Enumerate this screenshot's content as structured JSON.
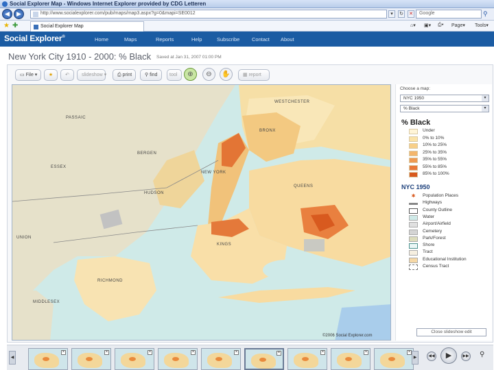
{
  "browser": {
    "title": "Social Explorer Map - Windows Internet Explorer provided by CDG Letteren",
    "address": "http://www.socialexplorer.com/pub/maps/map3.aspx?g=0&mapi=SE0012",
    "search_placeholder": "Google",
    "tab_label": "Social Explorer Map",
    "command_page": "Page",
    "command_tools": "Tools"
  },
  "site": {
    "logo": "Social Explorer",
    "logo_mark": "®",
    "nav": [
      "Home",
      "Maps",
      "Reports",
      "Help",
      "Subscribe",
      "Contact",
      "About"
    ]
  },
  "page": {
    "title": "New York City 1910 - 2000: % Black",
    "saved": "Saved at Jan 31, 2007 01:00 PM"
  },
  "toolbar": {
    "file": "File",
    "slideshow": "slideshow",
    "print": "print",
    "find": "find",
    "tool": "tool",
    "report": "report"
  },
  "map": {
    "labels": {
      "westchester": "WESTCHESTER",
      "passaic": "PASSAIC",
      "bergen": "BERGEN",
      "bronx": "BRONX",
      "essex": "ESSEX",
      "newyork": "NEW YORK",
      "hudson": "HUDSON",
      "queens": "QUEENS",
      "kings": "KINGS",
      "union": "UNION",
      "richmond": "RICHMOND",
      "middlesex": "MIDDLESEX"
    },
    "copyright": "©2006 Social Explorer.com"
  },
  "panel": {
    "choose_label": "Choose a map:",
    "year_select": "NYC 1950",
    "variable_select": "% Black",
    "legend_title": "% Black",
    "legend": [
      {
        "label": "Under",
        "color": "#fff5d8"
      },
      {
        "label": "0% to 10%",
        "color": "#fbe3a8"
      },
      {
        "label": "10% to 25%",
        "color": "#f8cf88"
      },
      {
        "label": "25% to 35%",
        "color": "#f4b66c"
      },
      {
        "label": "35% to 55%",
        "color": "#ef9a52"
      },
      {
        "label": "55% to 85%",
        "color": "#e9793a"
      },
      {
        "label": "85% to 100%",
        "color": "#d85a1f"
      }
    ],
    "reference_title": "NYC 1950",
    "reference": [
      {
        "label": "Population Places",
        "kind": "point"
      },
      {
        "label": "Highways",
        "kind": "line"
      },
      {
        "label": "County Outline",
        "kind": "outline"
      },
      {
        "label": "Water",
        "color": "#cfeae8"
      },
      {
        "label": "Airport/Airfield",
        "color": "#e0e0e0"
      },
      {
        "label": "Cemetery",
        "color": "#d4d4d4"
      },
      {
        "label": "Park/Forest",
        "color": "#dcdcbc"
      },
      {
        "label": "Shore",
        "kind": "shore"
      },
      {
        "label": "Tract",
        "color": "#f6efe0"
      },
      {
        "label": "Educational Institution",
        "color": "#f6d8a6"
      },
      {
        "label": "Census Tract",
        "kind": "dashed"
      }
    ],
    "slideshow_button": "Close slideshow edit"
  }
}
